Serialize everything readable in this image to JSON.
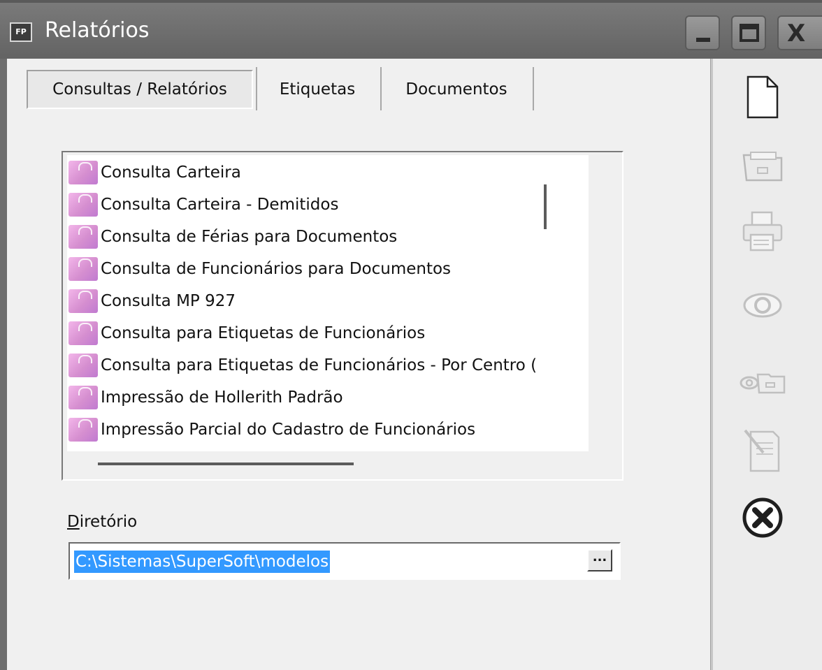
{
  "window": {
    "app_icon_text": "FP",
    "title": "Relatórios"
  },
  "tabs": [
    {
      "label": "Consultas / Relatórios",
      "active": true
    },
    {
      "label": "Etiquetas",
      "active": false
    },
    {
      "label": "Documentos",
      "active": false
    }
  ],
  "list": {
    "items": [
      "Consulta Carteira",
      "Consulta Carteira - Demitidos",
      "Consulta de Férias para Documentos",
      "Consulta de Funcionários para Documentos",
      "Consulta MP 927",
      "Consulta para Etiquetas de Funcionários",
      "Consulta para Etiquetas de Funcionários - Por Centro (",
      "Impressão de Hollerith Padrão",
      "Impressão Parcial do Cadastro de Funcionários"
    ],
    "item_icon": "report-icon"
  },
  "directory": {
    "label_underlined": "D",
    "label_rest": "iretório",
    "value": "C:\\Sistemas\\SuperSoft\\modelos",
    "browse_label": "..."
  },
  "toolbar": {
    "icons": [
      "new-document-icon",
      "open-folder-icon",
      "print-icon",
      "preview-icon",
      "preview-folder-icon",
      "edit-document-icon",
      "close-circle-icon"
    ]
  },
  "colors": {
    "titlebar": "#6e6e6e",
    "selection": "#3399ff",
    "item_icon": "#d68fd0"
  }
}
